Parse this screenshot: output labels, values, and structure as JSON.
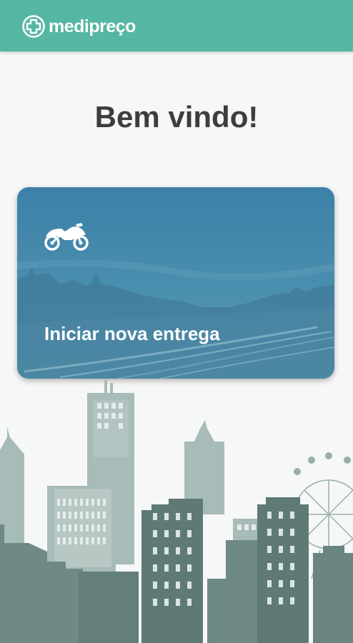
{
  "header": {
    "logo_text": "medipreço",
    "logo_icon": "medipreco-cross-logo-icon",
    "background_color": "#55b6a3"
  },
  "main": {
    "welcome_title": "Bem vindo!",
    "delivery_card": {
      "label": "Iniciar nova entrega",
      "icon": "motorcycle-icon",
      "background_color": "#3f86a8"
    }
  }
}
